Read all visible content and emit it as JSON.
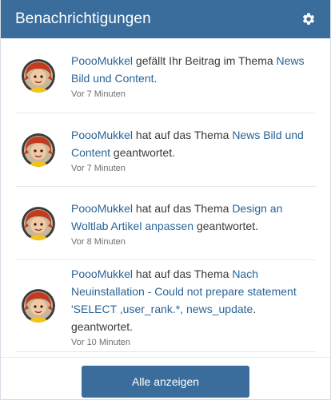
{
  "header": {
    "title": "Benachrichtigungen",
    "settings_icon": "gear-icon"
  },
  "colors": {
    "accent": "#3a6d9c",
    "link": "#2a6496"
  },
  "notifications": [
    {
      "user": "PoooMukkel",
      "action": " gefällt Ihr Beitrag im Thema ",
      "topic": "News Bild und Content",
      "suffix": ".",
      "time": "Vor 7 Minuten"
    },
    {
      "user": "PoooMukkel",
      "action": " hat auf das Thema ",
      "topic": "News Bild und Content",
      "suffix": " geantwortet.",
      "time": "Vor 7 Minuten"
    },
    {
      "user": "PoooMukkel",
      "action": " hat auf das Thema ",
      "topic": "Design an Woltlab Artikel anpassen",
      "suffix": " geantwortet.",
      "time": "Vor 8 Minuten"
    },
    {
      "user": "PoooMukkel",
      "action": " hat auf das Thema ",
      "topic": "Nach Neuinstallation - Could not prepare statement 'SELECT ,user_rank.*, news_update",
      "suffix": ". geantwortet.",
      "time": "Vor 10 Minuten"
    }
  ],
  "footer": {
    "show_all_label": "Alle anzeigen"
  }
}
